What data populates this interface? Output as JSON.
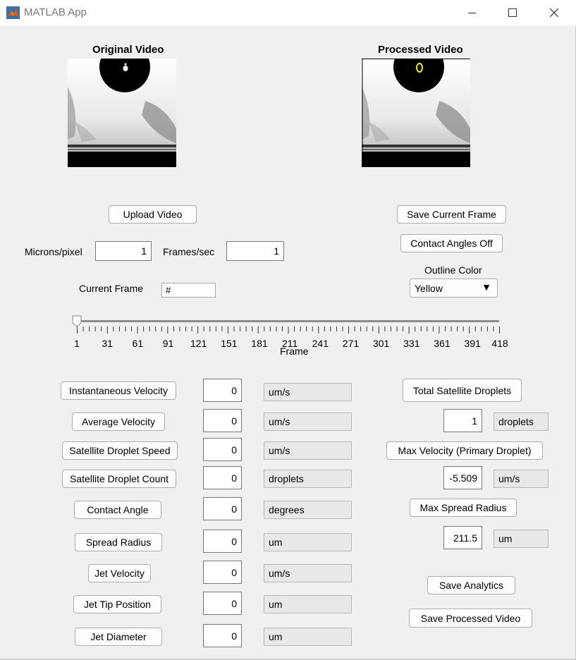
{
  "window": {
    "title": "MATLAB App"
  },
  "videos": {
    "original_title": "Original Video",
    "processed_title": "Processed Video"
  },
  "controls": {
    "upload_label": "Upload Video",
    "save_frame_label": "Save Current Frame",
    "contact_angles_label": "Contact Angles Off",
    "microns_label": "Microns/pixel",
    "microns_value": "1",
    "fps_label": "Frames/sec",
    "fps_value": "1",
    "current_frame_label": "Current Frame",
    "current_frame_value": "#",
    "outline_color_label": "Outline Color",
    "outline_color_value": "Yellow"
  },
  "slider": {
    "ticks": [
      "1",
      "31",
      "61",
      "91",
      "121",
      "151",
      "181",
      "211",
      "241",
      "271",
      "301",
      "331",
      "361",
      "391",
      "418"
    ],
    "axis_label": "Frame",
    "value": 1,
    "min": 1,
    "max": 418
  },
  "metrics": [
    {
      "label": "Instantaneous Velocity",
      "value": "0",
      "unit": "um/s"
    },
    {
      "label": "Average Velocity",
      "value": "0",
      "unit": "um/s"
    },
    {
      "label": "Satellite Droplet Speed",
      "value": "0",
      "unit": "um/s"
    },
    {
      "label": "Satellite Droplet Count",
      "value": "0",
      "unit": "droplets"
    },
    {
      "label": "Contact Angle",
      "value": "0",
      "unit": "degrees"
    },
    {
      "label": "Spread Radius",
      "value": "0",
      "unit": "um"
    },
    {
      "label": "Jet Velocity",
      "value": "0",
      "unit": "um/s"
    },
    {
      "label": "Jet Tip Position",
      "value": "0",
      "unit": "um"
    },
    {
      "label": "Jet Diameter",
      "value": "0",
      "unit": "um"
    }
  ],
  "right_metrics": [
    {
      "label": "Total Satellite Droplets",
      "value": "1",
      "unit": "droplets"
    },
    {
      "label": "Max Velocity (Primary Droplet)",
      "value": "-5.509",
      "unit": "um/s"
    },
    {
      "label": "Max Spread Radius",
      "value": "211.5",
      "unit": "um"
    }
  ],
  "actions": {
    "save_analytics_label": "Save Analytics",
    "save_processed_label": "Save Processed Video"
  },
  "colors": {
    "outline": "#f2ea10",
    "accent": "#e05a1a"
  }
}
